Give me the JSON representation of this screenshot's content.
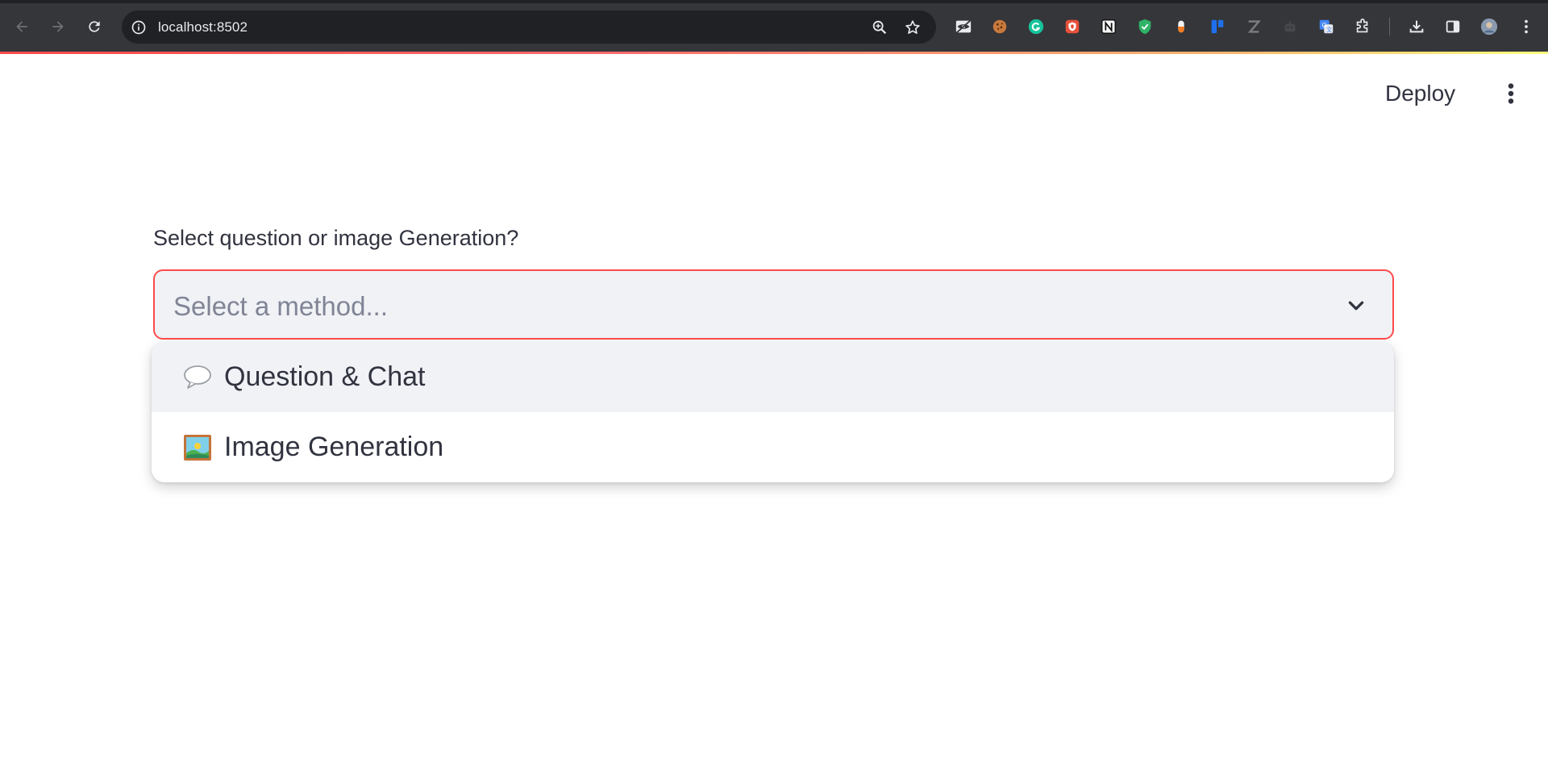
{
  "browser": {
    "url": "localhost:8502",
    "extensions": [
      "incognito-eye-icon",
      "cookie-icon",
      "grammarly-icon",
      "shield-red-icon",
      "notion-icon",
      "shield-green-icon",
      "pill-icon",
      "trello-icon",
      "zotero-icon",
      "robot-icon",
      "translate-icon",
      "puzzle-icon"
    ]
  },
  "header": {
    "deploy_label": "Deploy"
  },
  "form": {
    "label": "Select question or image Generation?",
    "select": {
      "placeholder": "Select a method...",
      "options": [
        {
          "icon": "speech-bubble-icon",
          "label": "Question & Chat",
          "highlighted": true
        },
        {
          "icon": "framed-picture-icon",
          "label": "Image Generation",
          "highlighted": false
        }
      ]
    }
  },
  "colors": {
    "accent": "#ff4b4b",
    "chrome_bg": "#35363a",
    "select_bg": "#f0f2f6",
    "text": "#31333f",
    "placeholder": "#808495"
  }
}
